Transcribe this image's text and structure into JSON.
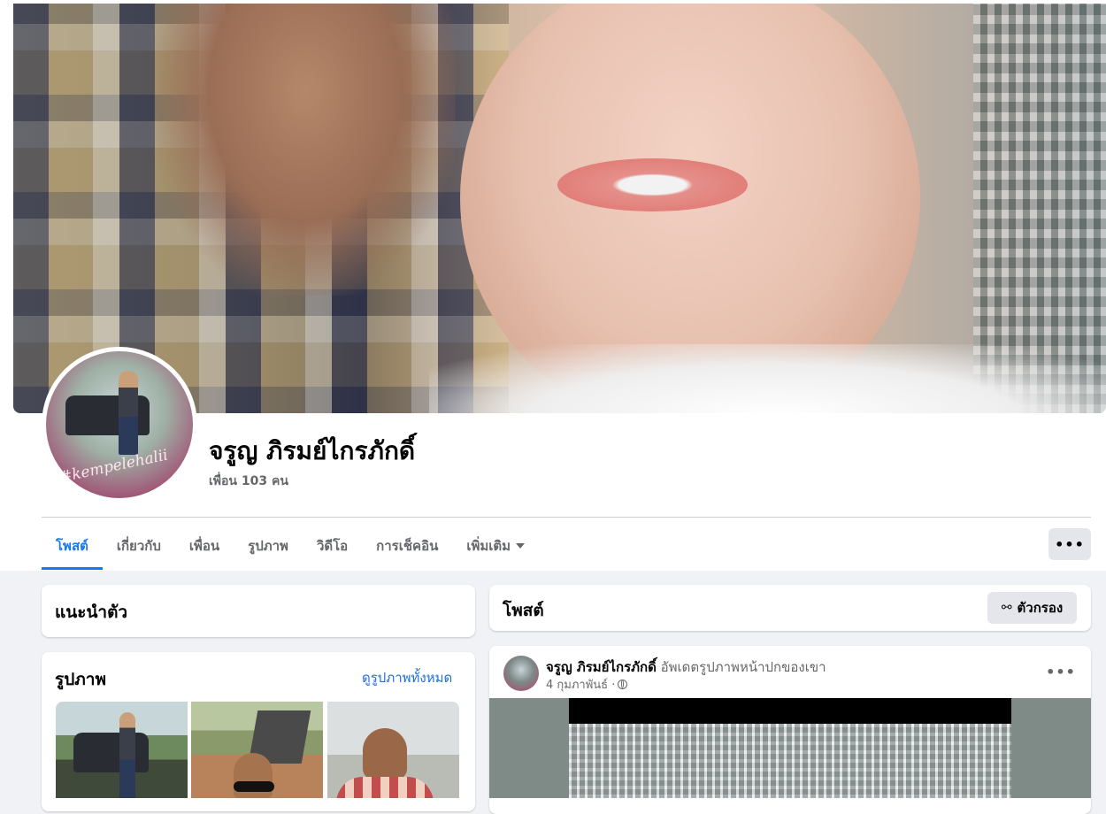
{
  "profile": {
    "name": "จรูญ ภิรมย์ไกรภักดิ์",
    "friends": "เพื่อน 103 คน",
    "avatar_tag": "#kempelehalii"
  },
  "tabs": [
    {
      "label": "โพสต์",
      "active": true
    },
    {
      "label": "เกี่ยวกับ"
    },
    {
      "label": "เพื่อน"
    },
    {
      "label": "รูปภาพ"
    },
    {
      "label": "วิดีโอ"
    },
    {
      "label": "การเช็คอิน"
    },
    {
      "label": "เพิ่มเติม"
    }
  ],
  "more_button": "•••",
  "intro": {
    "title": "แนะนำตัว"
  },
  "photos": {
    "title": "รูปภาพ",
    "see_all": "ดูรูปภาพทั้งหมด"
  },
  "posts": {
    "title": "โพสต์",
    "filter_label": "ตัวกรอง",
    "filter_icon": "⚯"
  },
  "post": {
    "author": "จรูญ ภิรมย์ไกรภักดิ์",
    "action": "อัพเดตรูปภาพหน้าปกของเขา",
    "date": "4 กุมภาพันธ์ ·",
    "more": "•••"
  },
  "colors": {
    "accent": "#1877f2",
    "link": "#216fdb",
    "background": "#f0f2f5",
    "muted": "#65676b"
  }
}
